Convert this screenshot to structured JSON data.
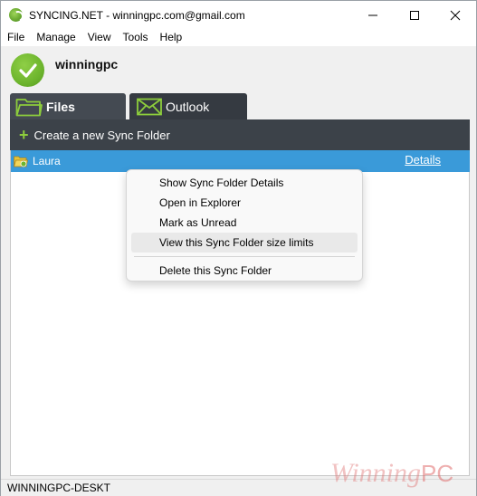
{
  "window": {
    "title": "SYNCING.NET - winningpc.com@gmail.com",
    "controls": {
      "minimize": "—",
      "maximize": "☐",
      "close": "✕"
    }
  },
  "menu": {
    "items": [
      "File",
      "Manage",
      "View",
      "Tools",
      "Help"
    ]
  },
  "account": {
    "name": "winningpc",
    "status_icon": "check-circle-icon"
  },
  "tabs": [
    {
      "label": "Files",
      "icon": "folder-icon",
      "active": true
    },
    {
      "label": "Outlook",
      "icon": "envelope-icon",
      "active": false
    }
  ],
  "toolbar": {
    "create_label": "Create a new Sync Folder",
    "create_icon": "plus-icon"
  },
  "list": {
    "rows": [
      {
        "name": "Laura",
        "details_label": "Details",
        "icon": "sync-folder-icon"
      }
    ]
  },
  "context_menu": {
    "items": [
      {
        "label": "Show Sync Folder Details",
        "highlighted": false
      },
      {
        "label": "Open in Explorer",
        "highlighted": false
      },
      {
        "label": "Mark as Unread",
        "highlighted": false
      },
      {
        "label": "View this Sync Folder size limits",
        "highlighted": true
      }
    ],
    "after_separator": [
      {
        "label": "Delete this Sync Folder",
        "highlighted": false
      }
    ]
  },
  "status": {
    "text": "WINNINGPC-DESKT"
  },
  "watermark": {
    "text": "Winning",
    "suffix": "PC"
  },
  "colors": {
    "accent_green": "#6db52d",
    "selection_blue": "#3a9ad9",
    "dark_toolbar": "#3c4249"
  }
}
